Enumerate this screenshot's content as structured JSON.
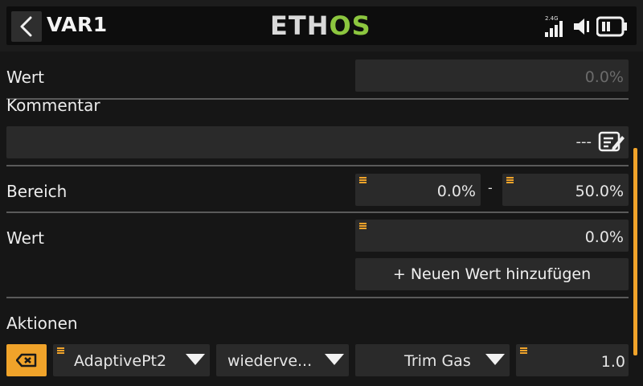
{
  "header": {
    "title": "VAR1",
    "logo_part1": "ETH",
    "logo_part2": "OS",
    "signal_band": "2.4G"
  },
  "rows": {
    "wert_top": {
      "label": "Wert",
      "value": "0.0%"
    },
    "kommentar": {
      "label": "Kommentar",
      "value": "---"
    },
    "bereich": {
      "label": "Bereich",
      "min": "0.0%",
      "separator": "-",
      "max": "50.0%"
    },
    "wert": {
      "label": "Wert",
      "value": "0.0%"
    },
    "add_button": "+ Neuen Wert hinzufügen"
  },
  "actions": {
    "label": "Aktionen",
    "source": "AdaptivePt2",
    "mode": "wiederve...",
    "target": "Trim Gas",
    "amount": "1.0"
  },
  "colors": {
    "accent": "#f0a32a",
    "logo_green": "#8cc63f",
    "field_bg": "#2a2a2a",
    "background": "#161616"
  }
}
